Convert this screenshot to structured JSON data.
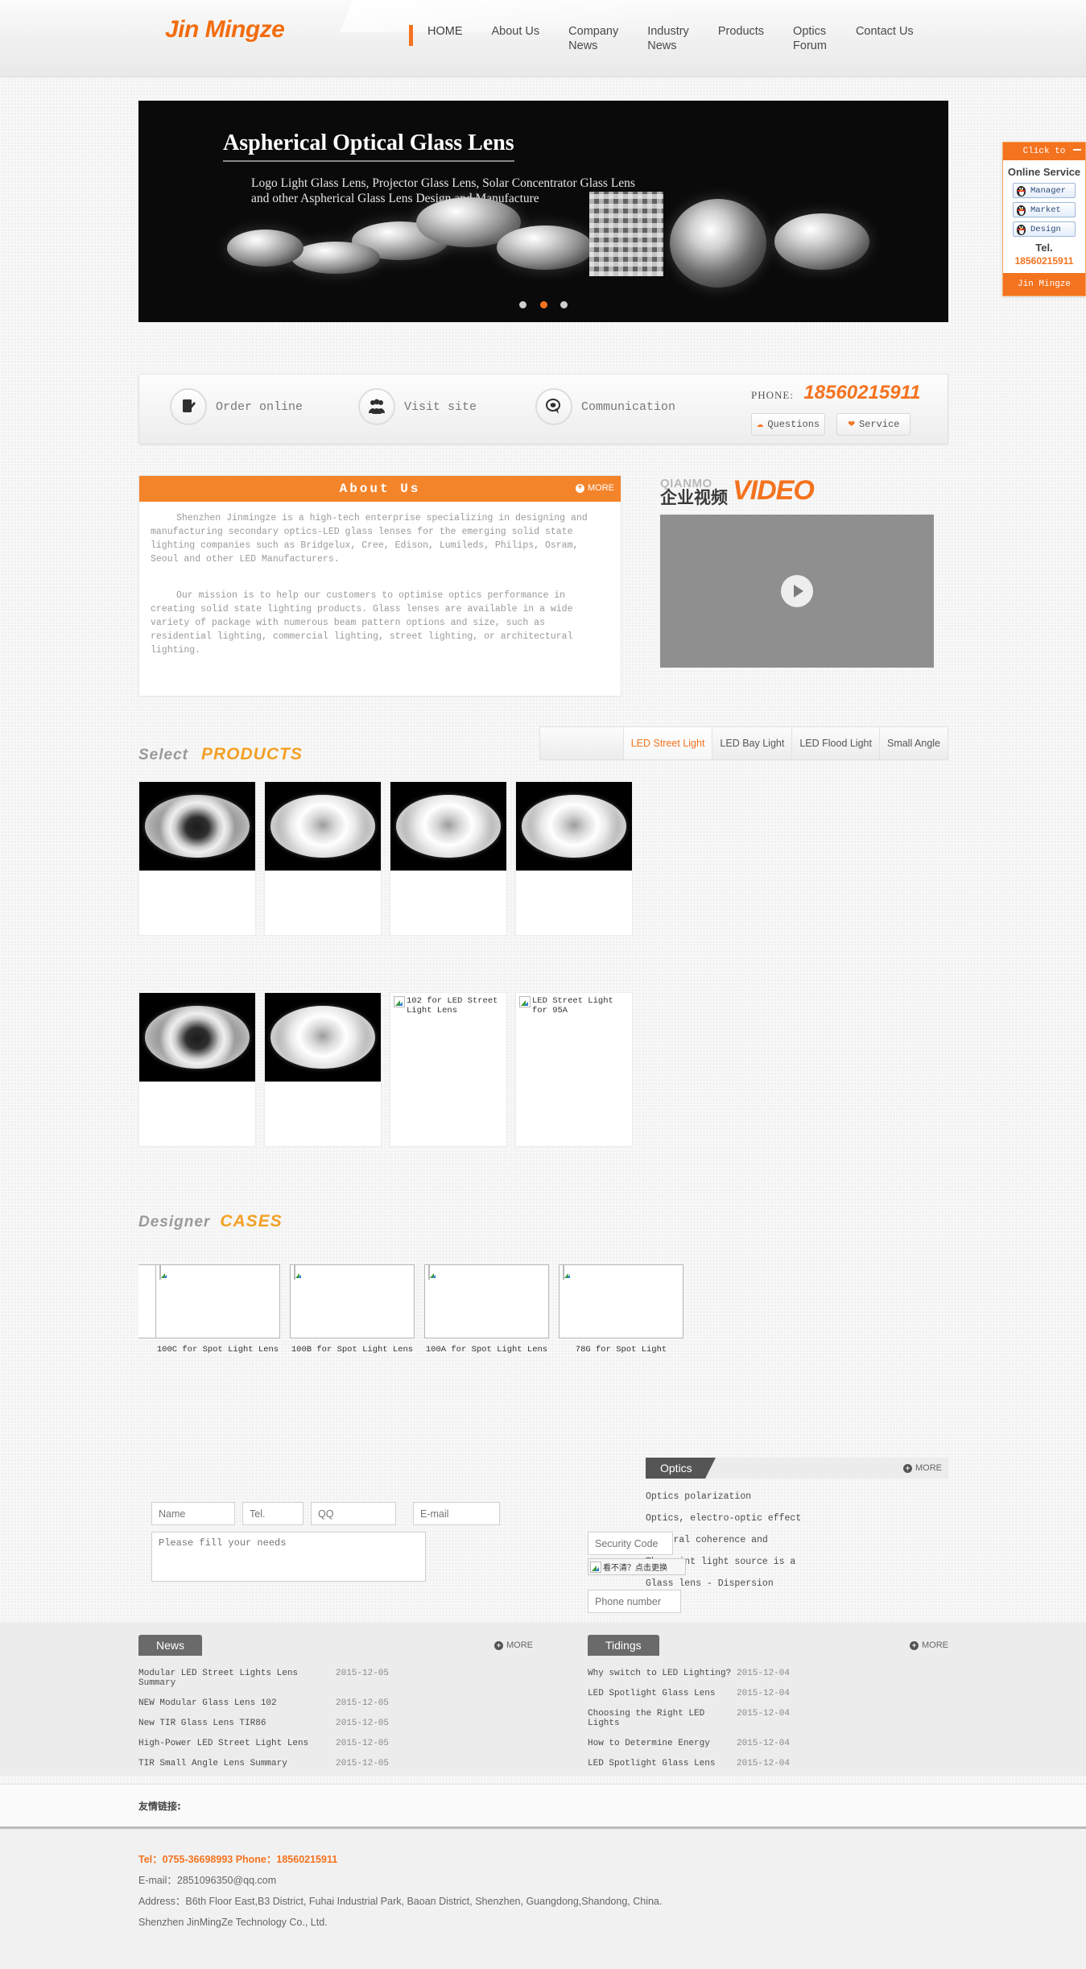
{
  "header": {
    "logo": "Jin Mingze",
    "nav": [
      {
        "label": "HOME",
        "active": true
      },
      {
        "label": "About Us",
        "active": false
      },
      {
        "label": "Company\nNews",
        "active": false
      },
      {
        "label": "Industry\nNews",
        "active": false
      },
      {
        "label": "Products",
        "active": false
      },
      {
        "label": "Optics\nForum",
        "active": false
      },
      {
        "label": "Contact Us",
        "active": false
      }
    ]
  },
  "banner": {
    "title": "Aspherical Optical Glass Lens",
    "subtitle": "Logo Light Glass Lens, Projector Glass Lens, Solar Concentrator Glass Lens\nand other Aspherical Glass Lens Design and Manufacture",
    "dots": 3,
    "active_dot": 2
  },
  "service_panel": {
    "top_label": "Click to",
    "title": "Online Service",
    "qq_items": [
      "Manager",
      "Market",
      "Design"
    ],
    "tel_label": "Tel.",
    "tel_number": "18560215911",
    "footer_label": "Jin Mingze"
  },
  "quickbar": {
    "items": [
      {
        "label": "Order online",
        "icon": "order-pen-icon"
      },
      {
        "label": "Visit site",
        "icon": "people-group-icon"
      },
      {
        "label": "Communication",
        "icon": "speech-bubble-icon"
      }
    ],
    "phone_label": "PHONE:",
    "phone_number": "18560215911",
    "buttons": [
      {
        "label": "Questions",
        "icon": "headset-icon"
      },
      {
        "label": "Service",
        "icon": "hands-heart-icon"
      }
    ]
  },
  "about": {
    "title": "About Us",
    "more": "MORE",
    "paragraph1": "Shenzhen Jinmingze is a high-tech enterprise specializing in designing and manufacturing secondary optics-LED glass lenses for the emerging solid state lighting companies such as Bridgelux, Cree, Edison, Lumileds, Philips, Osram, Seoul and other LED Manufacturers.",
    "paragraph2": "Our mission is to help our customers to optimise optics performance in creating solid state lighting products. Glass lenses are available in a wide variety of package with numerous beam pattern options and size, such as residential lighting, commercial lighting, street lighting, or architectural lighting."
  },
  "video": {
    "brand_en": "QIANMO",
    "brand_cn": "企业视频",
    "word": "VIDEO"
  },
  "products": {
    "head_select": "Select",
    "head_products": "PRODUCTS",
    "tabs": [
      {
        "label": "LED Street Light",
        "active": true
      },
      {
        "label": "LED Bay Light",
        "active": false
      },
      {
        "label": "LED Flood Light",
        "active": false
      },
      {
        "label": "Small Angle",
        "active": false
      }
    ],
    "items": [
      {
        "alt": "",
        "broken": false
      },
      {
        "alt": "",
        "broken": false
      },
      {
        "alt": "",
        "broken": false
      },
      {
        "alt": "",
        "broken": false
      },
      {
        "alt": "",
        "broken": false
      },
      {
        "alt": "",
        "broken": false
      },
      {
        "alt": "102 for LED Street Light Lens",
        "broken": true
      },
      {
        "alt": "LED Street Light for 95A",
        "broken": true
      }
    ]
  },
  "cases": {
    "head_designer": "Designer",
    "head_cases": "CASES",
    "items": [
      {
        "name": ""
      },
      {
        "name": "100C for Spot Light Lens"
      },
      {
        "name": "100B for Spot Light Lens"
      },
      {
        "name": "100A for Spot Light Lens"
      },
      {
        "name": "78G for Spot Light"
      }
    ]
  },
  "optics": {
    "title": "Optics",
    "more": "MORE",
    "links": [
      "Optics polarization",
      "Optics, electro-optic effect",
      "Temporal coherence and",
      "The point light source is a",
      "Glass lens - Dispersion"
    ]
  },
  "form": {
    "name_placeholder": "Name",
    "tel_placeholder": "Tel.",
    "qq_placeholder": "QQ",
    "email_placeholder": "E-mail",
    "needs_placeholder": "Please fill your needs",
    "security_placeholder": "Security Code",
    "captcha_text": "看不清？点击更换",
    "phone_placeholder": "Phone number"
  },
  "news": {
    "title": "News",
    "more": "MORE",
    "items": [
      {
        "title": "Modular LED Street Lights Lens Summary",
        "date": "2015-12-05"
      },
      {
        "title": "NEW Modular Glass Lens 102",
        "date": "2015-12-05"
      },
      {
        "title": "New TIR Glass Lens TIR86",
        "date": "2015-12-05"
      },
      {
        "title": "High-Power LED Street Light Lens",
        "date": "2015-12-05"
      },
      {
        "title": "TIR Small Angle Lens Summary",
        "date": "2015-12-05"
      }
    ]
  },
  "tidings": {
    "title": "Tidings",
    "more": "MORE",
    "items": [
      {
        "title": "Why switch to LED Lighting?",
        "date": "2015-12-04"
      },
      {
        "title": "LED Spotlight Glass Lens",
        "date": "2015-12-04"
      },
      {
        "title": "Choosing the Right LED Lights",
        "date": "2015-12-04"
      },
      {
        "title": "How to Determine Energy",
        "date": "2015-12-04"
      },
      {
        "title": "LED Spotlight Glass Lens",
        "date": "2015-12-04"
      }
    ]
  },
  "friendly_links": {
    "label": "友情链接:"
  },
  "footer": {
    "tel_line": "Tel：0755-36698993 Phone：18560215911",
    "email_line": "E-mail：2851096350@qq.com",
    "address_line": "Address：B6th Floor East,B3 District, Fuhai Industrial Park, Baoan District, Shenzhen, Guangdong,Shandong, China.",
    "company_line": "Shenzhen JinMingZe Technology Co., Ltd."
  },
  "colors": {
    "accent": "#f4731f",
    "accent_light": "#f4a024",
    "dark": "#555555"
  }
}
